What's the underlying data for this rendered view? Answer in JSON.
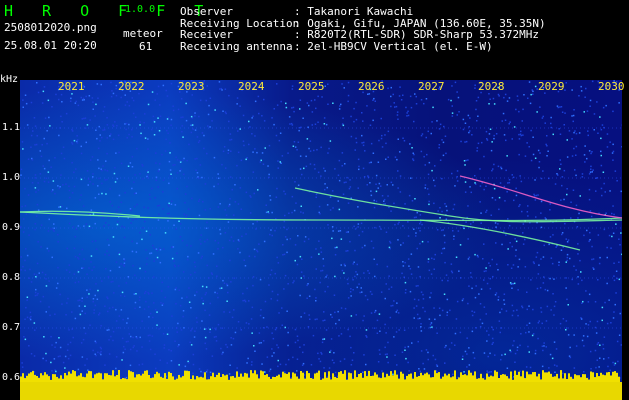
{
  "app": {
    "title": "H R O F F T",
    "version": "1.0.0"
  },
  "file": {
    "name": "2508012020.png",
    "datetime": "25.08.01 20:20"
  },
  "meteor": {
    "label": "meteor",
    "count": "61"
  },
  "info": [
    {
      "key": "Observer",
      "value": ": Takanori Kawachi"
    },
    {
      "key": "Receiving Location",
      "value": ": Ogaki, Gifu, JAPAN (136.60E, 35.35N)"
    },
    {
      "key": "Receiver",
      "value": ": R820T2(RTL-SDR) SDR-Sharp 53.372MHz"
    },
    {
      "key": "Receiving antenna",
      "value": ": 2el-HB9CV Vertical (el. E-W)"
    }
  ],
  "axis": {
    "y_unit": "kHz",
    "y_ticks": [
      "1.1",
      "1.0",
      "0.9",
      "0.8",
      "0.7",
      "0.6"
    ],
    "x_ticks": [
      "2021",
      "2022",
      "2023",
      "2024",
      "2025",
      "2026",
      "2027",
      "2028",
      "2029",
      "2030"
    ]
  },
  "colors": {
    "title": "#00ff00",
    "xaxis": "#ffeb3b",
    "trace": "#7fffa0"
  }
}
